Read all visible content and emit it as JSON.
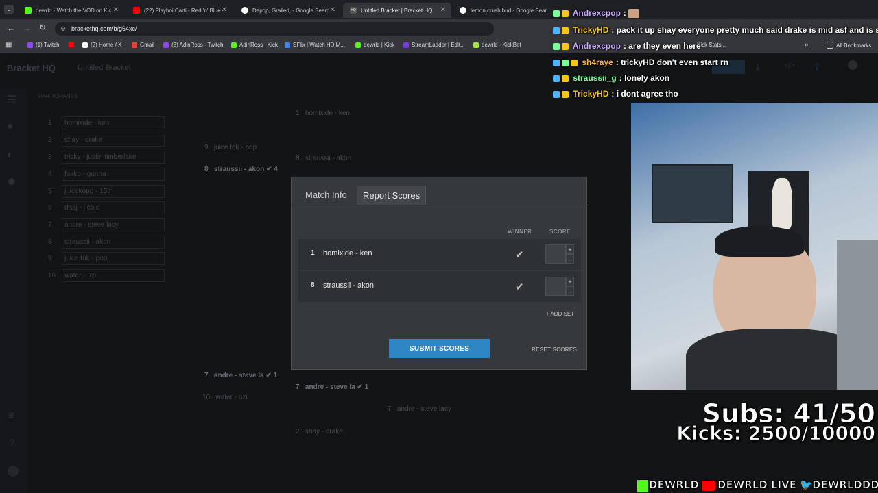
{
  "browser": {
    "tabs": [
      {
        "label": "dewrld - Watch the VOD on Kic",
        "color": "#53fc18"
      },
      {
        "label": "(22) Playboi Carti - Red 'n' Blue",
        "color": "#ff0000"
      },
      {
        "label": "Depop, Grailed, - Google Searc",
        "color": "#ffffff"
      },
      {
        "label": "Untitled Bracket | Bracket HQ",
        "color": "#444444"
      },
      {
        "label": "lemon crush bud - Google Sear",
        "color": "#ffffff"
      }
    ],
    "url": "brackethq.com/b/g64xc/",
    "bookmarks": [
      {
        "label": "(1) Twitch",
        "color": "#9146ff"
      },
      {
        "label": "",
        "color": "#ff0000"
      },
      {
        "label": "(2) Home / X",
        "color": "#ffffff"
      },
      {
        "label": "Gmail",
        "color": "#ea4335"
      },
      {
        "label": "(3) AdinRoss - Twitch",
        "color": "#9146ff"
      },
      {
        "label": "AdinRoss | Kick",
        "color": "#53fc18"
      },
      {
        "label": "SFlix | Watch HD M...",
        "color": "#3b82f6"
      },
      {
        "label": "dewrld | Kick",
        "color": "#53fc18"
      },
      {
        "label": "StreamLadder | Edit...",
        "color": "#7c3aed"
      },
      {
        "label": "dewrld - KickBot",
        "color": "#a3e635"
      },
      {
        "label": "Kick Stats...",
        "color": "#53fc18"
      }
    ],
    "all_bookmarks": "All Bookmarks"
  },
  "app": {
    "logo": "Bracket HQ",
    "bracket_title": "Untitled Bracket",
    "participants_label": "PARTICIPANTS",
    "participants": [
      {
        "seed": "1",
        "name": "homixide - ken"
      },
      {
        "seed": "2",
        "name": "shay - drake"
      },
      {
        "seed": "3",
        "name": "tricky - justin timberlake"
      },
      {
        "seed": "4",
        "name": "fakko - gunna"
      },
      {
        "seed": "5",
        "name": "juicekopp - 15th"
      },
      {
        "seed": "6",
        "name": "daaj - j cole"
      },
      {
        "seed": "7",
        "name": "andre - steve lacy"
      },
      {
        "seed": "8",
        "name": "straussii - akon"
      },
      {
        "seed": "9",
        "name": "juice tok - pop"
      },
      {
        "seed": "10",
        "name": "water - uzi"
      }
    ],
    "bracket": [
      {
        "seed": "1",
        "name": "homixide - ken"
      },
      {
        "seed": "8",
        "name": "straussii - akon"
      },
      {
        "seed": "9",
        "name": "juice tok - pop"
      },
      {
        "seed": "8",
        "name": "straussii - akon",
        "score": "4"
      },
      {
        "seed": "7",
        "name": "andre - steve la",
        "score": "1"
      },
      {
        "seed": "10",
        "name": "water - uzi"
      },
      {
        "seed": "7",
        "name": "andre - steve la",
        "score": "1"
      },
      {
        "seed": "7",
        "name": "andre - steve lacy"
      },
      {
        "seed": "2",
        "name": "shay - drake"
      }
    ]
  },
  "modal": {
    "tabs": [
      "Match Info",
      "Report Scores"
    ],
    "winner_header": "WINNER",
    "score_header": "SCORE",
    "rows": [
      {
        "seed": "1",
        "name": "homixide - ken",
        "score": ""
      },
      {
        "seed": "8",
        "name": "straussii - akon",
        "score": ""
      }
    ],
    "add_set": "+ ADD SET",
    "submit": "SUBMIT SCORES",
    "reset": "RESET SCORES"
  },
  "chat": [
    {
      "user": "Andrexcpop",
      "color": "#c9a7ff",
      "msg": ""
    },
    {
      "user": "TrickyHD",
      "color": "#f5c518",
      "msg": "pack it up shay everyone pretty much said drake is mid asf and is sh"
    },
    {
      "user": "Andrexcpop",
      "color": "#c9a7ff",
      "msg": "are they even here"
    },
    {
      "user": "sh4raye",
      "color": "#ffb347",
      "msg": "trickyHD don't even start rn"
    },
    {
      "user": "straussii_g",
      "color": "#7dff9a",
      "msg": "lonely akon"
    },
    {
      "user": "TrickyHD",
      "color": "#f5c518",
      "msg": "i dont agree tho"
    }
  ],
  "overlay": {
    "subs": "Subs: 41/50",
    "kicks": "Kicks: 2500/10000",
    "socials": [
      "DEWRLD",
      "DEWRLD LIVE",
      "DEWRLDDD"
    ]
  }
}
